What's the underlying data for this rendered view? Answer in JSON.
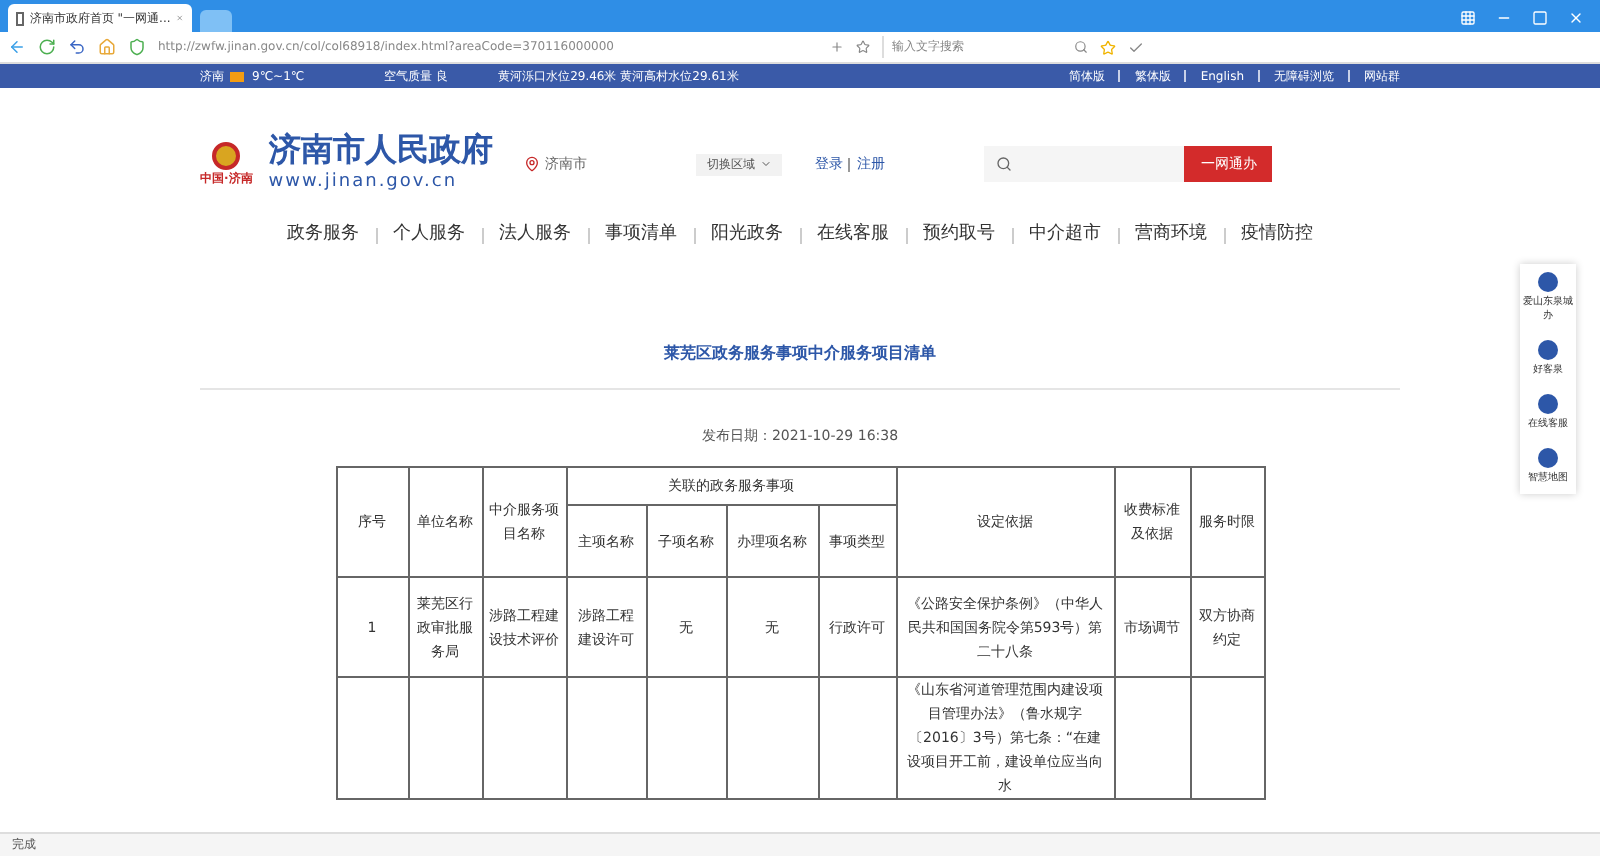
{
  "browser": {
    "tab_title": "济南市政府首页 \"一网通...",
    "url": "http://zwfw.jinan.gov.cn/col/col68918/index.html?areaCode=370116000000",
    "search": {
      "placeholder": "输入文字搜索"
    }
  },
  "info_bar": {
    "city": "济南",
    "temperature": "9℃~1℃",
    "air_quality": "空气质量 良",
    "water_levels": "黄河泺口水位29.46米 黄河高村水位29.61米",
    "links": [
      "简体版",
      "繁体版",
      "English",
      "无障碍浏览",
      "网站群"
    ]
  },
  "header": {
    "emblem_caption": "中国·济南",
    "site_name": "济南市人民政府",
    "site_url": "www.jinan.gov.cn",
    "location": "济南市",
    "region_select": "切换区域",
    "login": "登录",
    "register": "注册",
    "search_button": "一网通办"
  },
  "nav": [
    "政务服务",
    "个人服务",
    "法人服务",
    "事项清单",
    "阳光政务",
    "在线客服",
    "预约取号",
    "中介超市",
    "营商环境",
    "疫情防控"
  ],
  "article": {
    "title": "莱芜区政务服务事项中介服务项目清单",
    "publish_date": "发布日期：2021-10-29 16:38"
  },
  "table": {
    "headers": {
      "index": "序号",
      "unit": "单位名称",
      "project": "中介服务项目名称",
      "related": "关联的政务服务事项",
      "main_item": "主项名称",
      "sub_item": "子项名称",
      "handling_item": "办理项名称",
      "item_type": "事项类型",
      "basis": "设定依据",
      "fee": "收费标准及依据",
      "time_limit": "服务时限"
    },
    "rows": [
      {
        "index": "1",
        "unit": "莱芜区行政审批服务局",
        "project": "涉路工程建设技术评价",
        "main_item": "涉路工程建设许可",
        "sub_item": "无",
        "handling_item": "无",
        "item_type": "行政许可",
        "basis": "《公路安全保护条例》（中华人民共和国国务院令第593号）第二十八条",
        "fee": "市场调节",
        "time_limit": "双方协商约定"
      },
      {
        "basis": "《山东省河道管理范围内建设项目管理办法》（鲁水规字〔2016〕3号）第七条：“在建设项目开工前，建设单位应当向水"
      }
    ]
  },
  "side_tools": [
    "爱山东泉城办",
    "好客泉",
    "在线客服",
    "智慧地图"
  ],
  "status_bar": {
    "text": "完成"
  }
}
